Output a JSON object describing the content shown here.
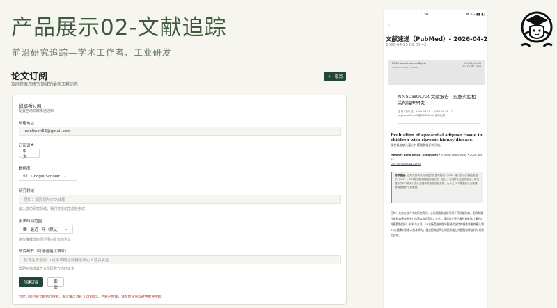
{
  "hero": {
    "title": "产品展示02-文献追踪",
    "subtitle": "前沿研究追踪—学术工作者、工业研发"
  },
  "section": {
    "title": "论文订阅",
    "desc": "及时获取您研究领域的最新文献动态",
    "cancel_label": "取消",
    "cancel_plus": "+"
  },
  "form": {
    "heading": "创建新订阅",
    "heading_sub": "配置自动文献推送通知",
    "email": {
      "label": "邮箱地址",
      "value": "luanliwen66@gmail.com"
    },
    "language": {
      "label": "订阅语言",
      "value": "中文"
    },
    "database": {
      "label": "数据库",
      "badge": "GS",
      "value": "Google Scholar"
    },
    "field": {
      "label": "研究领域",
      "placeholder": "例如：糖尿病与CTA成像",
      "help": "输入您的研究领域，我们将自动生成检索式"
    },
    "range": {
      "label": "发表时间范围",
      "value": "最近一年（默认）",
      "help": "将仅推荐此时间范围内发表的论文"
    },
    "detail": {
      "label": "研究细节（可选但建议填写）",
      "placeholder": "我专注于使用CT成像早期检测糖尿病心血管并发症...",
      "help": "帮助AI筛选最符合您研究方向的论文"
    },
    "submit_label": "创建订阅",
    "cancel_label": "取消",
    "footnote": "创建订阅后将立即执行搜索。每次每次消耗 2 credits。若账户余额，请及时充值以避免推送中断。"
  },
  "phone": {
    "time": "1:38",
    "signal": "⚙ 5G ▮▮ ◧",
    "title": "文献速递（PubMed）- 2026-04-25",
    "date": "2026-04-25 08:00:42",
    "banner_left": "NNScholar Academic Digest",
    "banner_left2": "ISSN: 2970-0847 (Online)",
    "banner_right": "Vol. 26, No. 04\nFri, 25 Apr 2026",
    "report_title": "NNSCHOLAR 文献报告 - 冠脉炎腔相关的临床研究",
    "meta1": "检 索 时 间 段：2026-04-05  →  2026-04-24  •  7",
    "meta2": "papers selected   由NNScholar自动生成",
    "article_title": "Evaluation of epicardial adipose tissue in children with chronic kidney disease.",
    "article_cn": "慢性肾脏病儿童心外膜脂肪组织的评估。",
    "authors_bold": "Mehmet Baha Aytac, Kenan Bek",
    "authors_rest": "•  Clinical nephrology  •  2026 Apr 23",
    "doi": "DOI: 10.5414/CN111703",
    "rec_label": "推荐理由：",
    "rec_text": "该研究首次系统评估了慢性肾脏病（CKD）患儿的心外膜脂肪组织（EAT）。EAT是冠脉周围脂肪组织的一部分，与冠脉炎症密切相关。研究提示了EAT作为儿童心血管风险的潜在标志物，为小儿CKD患者的心血管健康管理提供了新思路。",
    "body": "目的：先前在成人中的研究表明，心外膜脂肪组织可用于预测糖尿病、肥胖和慢性肾脏病患者发生心血管疾病的风险。在此，我们旨在评估慢性肾脏病儿童的心外膜脂肪组织。材料与方法：23名接受维持性肾脏替代治疗的慢性肾脏病患儿和23名健康对照者入组本研究。通过经胸超声心动图测量心外膜脂肪厚度并与对照组比较。"
  }
}
